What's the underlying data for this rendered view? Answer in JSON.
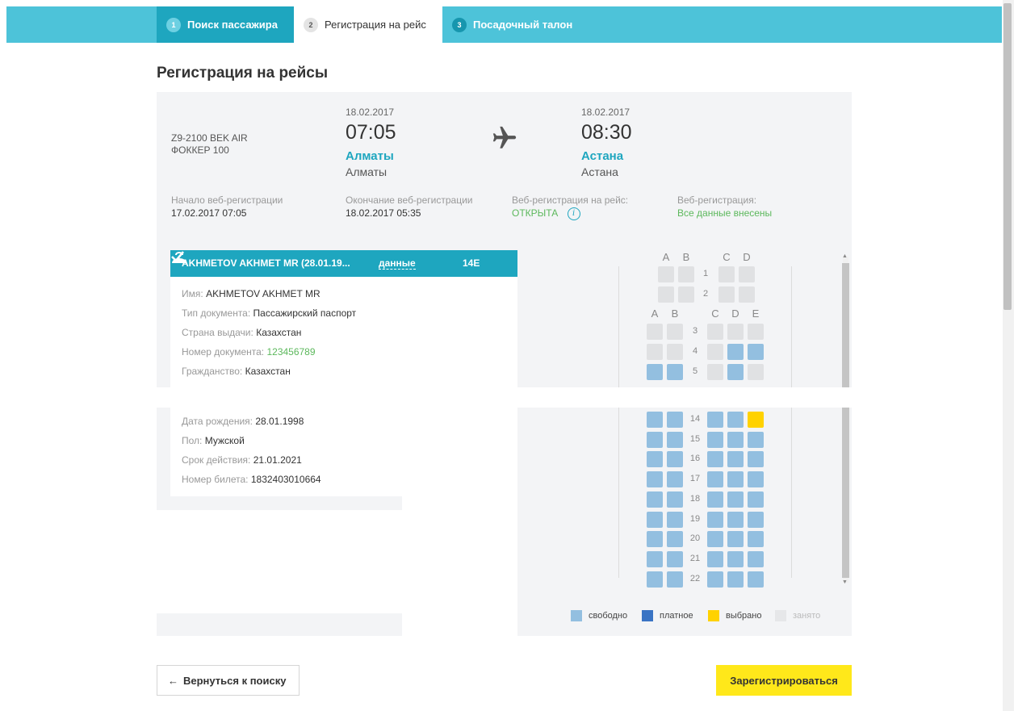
{
  "steps": [
    {
      "num": "1",
      "label": "Поиск пассажира"
    },
    {
      "num": "2",
      "label": "Регистрация на рейс"
    },
    {
      "num": "3",
      "label": "Посадочный талон"
    }
  ],
  "page_title": "Регистрация на рейсы",
  "flight": {
    "code": "Z9-2100 BEK AIR",
    "aircraft": "ФОККЕР 100",
    "departure": {
      "date": "18.02.2017",
      "time": "07:05",
      "city": "Алматы",
      "airport": "Алматы"
    },
    "arrival": {
      "date": "18.02.2017",
      "time": "08:30",
      "city": "Астана",
      "airport": "Астана"
    },
    "plane_icon": "airplane-icon",
    "checkin_start_label": "Начало веб-регистрации",
    "checkin_start": "17.02.2017 07:05",
    "checkin_end_label": "Окончание веб-регистрации",
    "checkin_end": "18.02.2017 05:35",
    "checkin_status_label": "Веб-регистрация на рейс:",
    "checkin_status": "ОТКРЫТА",
    "info_glyph": "i",
    "webreg_label": "Веб-регистрация:",
    "webreg_status": "Все данные внесены"
  },
  "passenger": {
    "header_name": "AKHMETOV AKHMET MR (28.01.19...",
    "data_link": "данные",
    "seat": "14E",
    "fields": [
      {
        "key": "Имя:",
        "value": "AKHMETOV AKHMET MR"
      },
      {
        "key": "Тип документа:",
        "value": "Пассажирский паспорт"
      },
      {
        "key": "Страна выдачи:",
        "value": "Казахстан"
      },
      {
        "key": "Номер документа:",
        "value": "123456789"
      },
      {
        "key": "Гражданство:",
        "value": "Казахстан"
      },
      {
        "key": "Дата рождения:",
        "value": "28.01.1998"
      },
      {
        "key": "Пол:",
        "value": "Мужской"
      },
      {
        "key": "Срок действия:",
        "value": "21.01.2021"
      },
      {
        "key": "Номер билета:",
        "value": "1832403010664"
      }
    ]
  },
  "seatmap": {
    "business_cols": [
      "A",
      "B",
      "C",
      "D"
    ],
    "economy_cols": [
      "A",
      "B",
      "C",
      "D",
      "E"
    ],
    "business_rows": [
      {
        "row": "1",
        "seats": [
          "occ",
          "occ",
          "occ",
          "occ"
        ]
      },
      {
        "row": "2",
        "seats": [
          "occ",
          "occ",
          "occ",
          "occ"
        ]
      }
    ],
    "economy_rows_top": [
      {
        "row": "3",
        "seats": [
          "occ",
          "occ",
          "occ",
          "occ",
          "occ"
        ]
      },
      {
        "row": "4",
        "seats": [
          "occ",
          "occ",
          "occ",
          "free",
          "free"
        ]
      },
      {
        "row": "5",
        "seats": [
          "free",
          "free",
          "occ",
          "free",
          "occ"
        ]
      }
    ],
    "economy_rows_bottom": [
      {
        "row": "14",
        "seats": [
          "free",
          "free",
          "free",
          "free",
          "sel"
        ]
      },
      {
        "row": "15",
        "seats": [
          "free",
          "free",
          "free",
          "free",
          "free"
        ]
      },
      {
        "row": "16",
        "seats": [
          "free",
          "free",
          "free",
          "free",
          "free"
        ]
      },
      {
        "row": "17",
        "seats": [
          "free",
          "free",
          "free",
          "free",
          "free"
        ]
      },
      {
        "row": "18",
        "seats": [
          "free",
          "free",
          "free",
          "free",
          "free"
        ]
      },
      {
        "row": "19",
        "seats": [
          "free",
          "free",
          "free",
          "free",
          "free"
        ]
      },
      {
        "row": "20",
        "seats": [
          "free",
          "free",
          "free",
          "free",
          "free"
        ]
      },
      {
        "row": "21",
        "seats": [
          "free",
          "free",
          "free",
          "free",
          "free"
        ]
      },
      {
        "row": "22",
        "seats": [
          "free",
          "free",
          "free",
          "free",
          "free"
        ]
      }
    ],
    "legend": [
      {
        "label": "свободно",
        "color": "#93bfe0"
      },
      {
        "label": "платное",
        "color": "#3a74c4"
      },
      {
        "label": "выбрано",
        "color": "#ffd200"
      },
      {
        "label": "занято",
        "color": "#e6e7e9"
      }
    ],
    "scroll_up": "▲",
    "scroll_down": "▼"
  },
  "buttons": {
    "back_arrow": "←",
    "back": "Вернуться к поиску",
    "register": "Зарегистрироваться"
  },
  "colors": {
    "accent": "#4dc3d9",
    "accent_dark": "#1ea6bf",
    "ok_green": "#5cb85c",
    "cta_yellow": "#ffe81a"
  }
}
